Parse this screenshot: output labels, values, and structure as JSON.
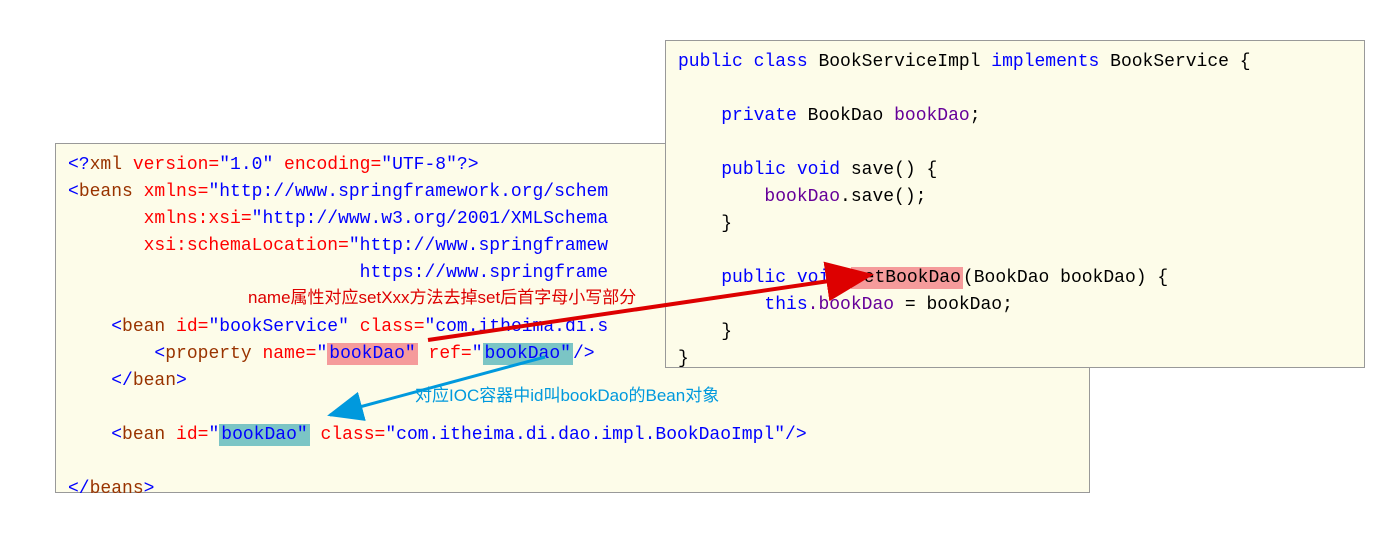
{
  "xml": {
    "decl_open": "<?",
    "decl_xml": "xml",
    "decl_version_attr": " version=",
    "decl_version_val": "\"1.0\"",
    "decl_encoding_attr": " encoding=",
    "decl_encoding_val": "\"UTF-8\"",
    "decl_close": "?>",
    "beans_open_lt": "<",
    "beans": "beans",
    "xmlns_attr": " xmlns=",
    "xmlns_val": "\"http://www.springframework.org/schem",
    "xmlns_xsi_attr": "xmlns:xsi=",
    "xmlns_xsi_val": "\"http://www.w3.org/2001/XMLSchema",
    "xsi_loc_attr": "xsi:schemaLocation=",
    "xsi_loc_val1": "\"http://www.springframew",
    "xsi_loc_val2": "https://www.springframe",
    "bean1_lt": "<",
    "bean1_name": "bean",
    "bean1_id_attr": " id=",
    "bean1_id_val": "\"bookService\"",
    "bean1_class_attr": " class=",
    "bean1_class_val": "\"com.itheima.di.s",
    "prop_lt": "<",
    "prop_name": "property",
    "prop_name_attr": " name=",
    "prop_name_val_q": "\"",
    "prop_name_val": "bookDao",
    "prop_ref_attr": " ref=",
    "prop_ref_val_q": "\"",
    "prop_ref_val": "bookDao",
    "prop_close": "/>",
    "bean1_close_lt": "</",
    "bean1_close_name": "bean",
    "bean1_close_gt": ">",
    "bean2_lt": "<",
    "bean2_name": "bean",
    "bean2_id_attr": " id=",
    "bean2_id_val_q": "\"",
    "bean2_id_val": "bookDao",
    "bean2_class_attr": " class=",
    "bean2_class_val": "\"com.itheima.di.dao.impl.BookDaoImpl\"",
    "bean2_close": "/>",
    "beans_close_lt": "</",
    "beans_close_name": "beans",
    "beans_close_gt": ">"
  },
  "java": {
    "public": "public",
    "class": "class",
    "classname": "BookServiceImpl",
    "implements": "implements",
    "iface": "BookService",
    "lbrace": " {",
    "private": "private",
    "type_bookdao": "BookDao",
    "field_bookdao": "bookDao",
    "semi": ";",
    "void": "void",
    "save": "save",
    "parens": "()",
    "save_body": "bookDao.save();",
    "rbrace": "}",
    "setBookDao": "setBookDao",
    "param_type": "BookDao",
    "param_name": "bookDao",
    "this": "this",
    "dot_bookdao": ".bookDao",
    "eq": " = ",
    "assign_bookdao": "bookDao;"
  },
  "annotations": {
    "red_text": "name属性对应setXxx方法去掉set后首字母小写部分",
    "blue_text": "对应IOC容器中id叫bookDao的Bean对象"
  }
}
